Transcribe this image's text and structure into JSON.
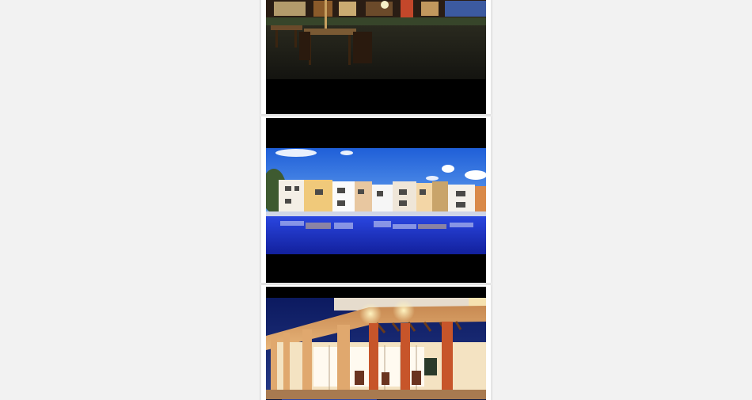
{
  "feed": {
    "photos": [
      {
        "subject": "night-terrace-with-tables",
        "icon": "photo-icon"
      },
      {
        "subject": "townhouses-reflected-in-pool",
        "icon": "photo-icon"
      },
      {
        "subject": "illuminated-clubhouse-at-dusk",
        "icon": "photo-icon"
      }
    ]
  },
  "colors": {
    "page_background": "#f2f2f2",
    "card_background": "#ffffff",
    "letterbox": "#000000",
    "sky_blue": "#2f6fe0",
    "pool_blue": "#1b2fd0",
    "dusk_navy": "#1a2a6c",
    "warm_light": "#f0a640"
  }
}
